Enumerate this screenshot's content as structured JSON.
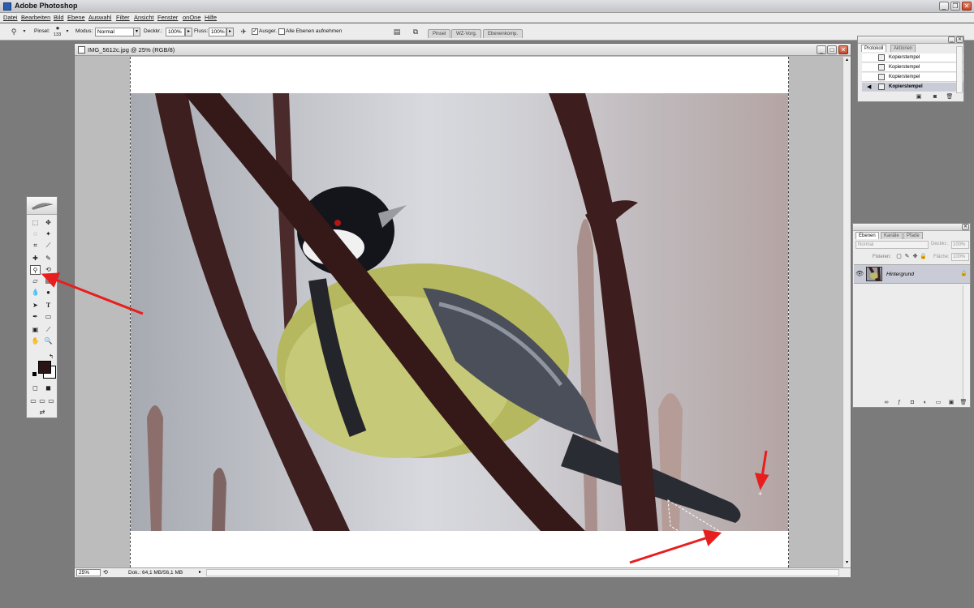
{
  "app": {
    "title": "Adobe Photoshop"
  },
  "menu": [
    "Datei",
    "Bearbeiten",
    "Bild",
    "Ebene",
    "Auswahl",
    "Filter",
    "Ansicht",
    "Fenster",
    "onOne",
    "Hilfe"
  ],
  "options": {
    "brush_label": "Pinsel:",
    "brush_size": "133",
    "mode_label": "Modus:",
    "mode_value": "Normal",
    "opacity_label": "Deckkr.:",
    "opacity_value": "100%",
    "flow_label": "Fluss:",
    "flow_value": "100%",
    "aligned_label": "Ausger.",
    "aligned_checked": true,
    "all_layers_label": "Alle Ebenen aufnehmen",
    "all_layers_checked": false,
    "well_tabs": [
      "Pinsel",
      "WZ-Vorg.",
      "Ebenenkomp."
    ]
  },
  "document": {
    "title": "IMG_5612c.jpg @ 25% (RGB/8)",
    "zoom": "25%",
    "doc_size": "Dok.: 64,1 MB/56,1 MB"
  },
  "history_panel": {
    "tabs": [
      "Protokoll",
      "Aktionen"
    ],
    "items": [
      "Kopierstempel",
      "Kopierstempel",
      "Kopierstempel",
      "Kopierstempel"
    ],
    "selected_index": 3
  },
  "layers_panel": {
    "tabs": [
      "Ebenen",
      "Kanäle",
      "Pfade"
    ],
    "blend_mode": "Normal",
    "opacity_label": "Deckkr.:",
    "opacity_value": "100%",
    "lock_label": "Fixieren:",
    "fill_label": "Fläche:",
    "fill_value": "100%",
    "layer_name": "Hintergrund"
  },
  "colors": {
    "foreground": "#2a1414",
    "background": "#ffffff",
    "annotation_arrow": "#e81e1e",
    "selected_row": "#c9ccd6"
  }
}
